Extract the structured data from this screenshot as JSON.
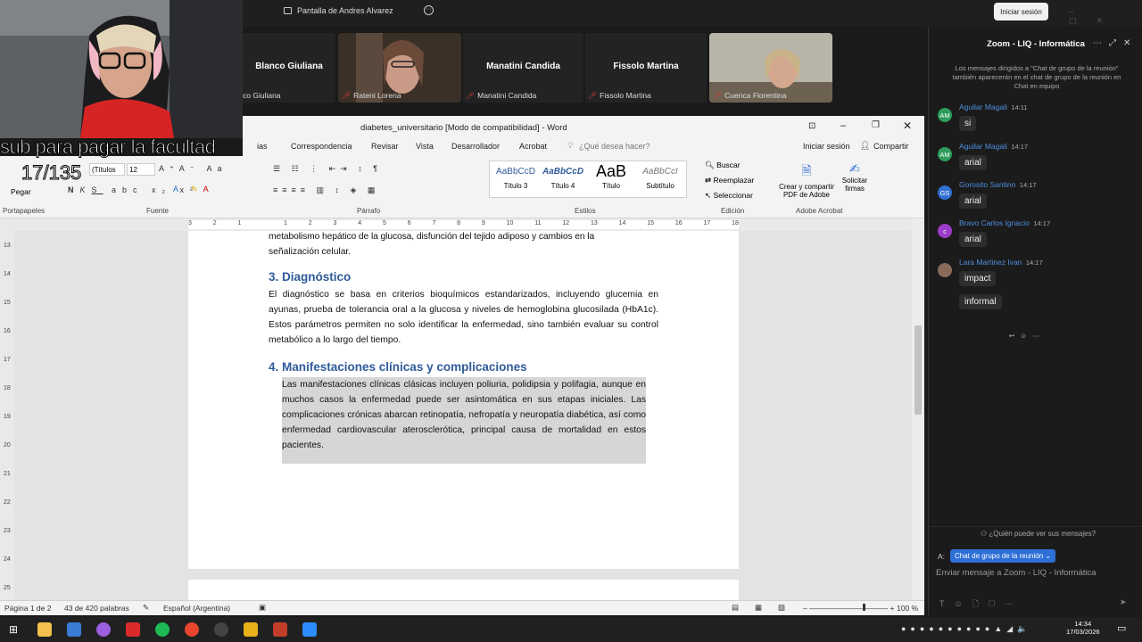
{
  "zoom": {
    "sharing_label": "Pantalla de Andres Alvarez",
    "signin_label": "Iniciar sesión",
    "participants": [
      {
        "name": "Blanco Giuliana",
        "label": "co Giuliana"
      },
      {
        "name": "",
        "label": "Rateni Lorena"
      },
      {
        "name": "Manatini Candida",
        "label": "Manatini Candida"
      },
      {
        "name": "Fissolo Martina",
        "label": "Fissolo Martina"
      },
      {
        "name": "",
        "label": "Cuenca Florentina"
      }
    ]
  },
  "overlay": {
    "line1": "sub para pagar la facultad",
    "line2": "17/135"
  },
  "word": {
    "title": "diabetes_universitario [Modo de compatibilidad] - Word",
    "menu": [
      "ias",
      "Correspondencia",
      "Revisar",
      "Vista",
      "Desarrollador",
      "Acrobat"
    ],
    "tell_me": "¿Qué desea hacer?",
    "signin": "Iniciar sesión",
    "share": "Compartir",
    "ribbon": {
      "paste": "Pegar",
      "font_name": "(Títulos",
      "font_size": "12",
      "groups": [
        "Portapapeles",
        "Fuente",
        "Párrafo",
        "Estilos",
        "Edición",
        "Adobe Acrobat"
      ],
      "styles": [
        {
          "preview": "AaBbCcD",
          "name": "Título 3"
        },
        {
          "preview": "AaBbCcD",
          "name": "Título 4"
        },
        {
          "preview": "AaB",
          "name": "Título"
        },
        {
          "preview": "AaBbCcI",
          "name": "Subtítulo"
        }
      ],
      "find": "Buscar",
      "replace": "Reemplazar",
      "select": "Seleccionar",
      "acrobat_create": "Crear y compartir PDF de Adobe",
      "acrobat_sign": "Solicitar firmas"
    },
    "ruler_numbers": [
      "3",
      "2",
      "1",
      "",
      "1",
      "2",
      "3",
      "4",
      "5",
      "6",
      "7",
      "8",
      "9",
      "10",
      "11",
      "12",
      "13",
      "14",
      "15",
      "16",
      "17",
      "18"
    ],
    "vruler_numbers": [
      "13",
      "14",
      "15",
      "16",
      "17",
      "18",
      "19",
      "20",
      "21",
      "22",
      "23",
      "24",
      "25"
    ],
    "doc": {
      "para1_line1": "metabolismo hepático de la glucosa, disfunción del tejido adiposo y cambios en la",
      "para1_line2": "señalización celular.",
      "h3": "3. Diagnóstico",
      "para2": "El diagnóstico se basa en criterios bioquímicos estandarizados, incluyendo glucemia en ayunas, prueba de tolerancia oral a la glucosa y niveles de hemoglobina glucosilada (HbA1c). Estos parámetros permiten no solo identificar la enfermedad, sino también evaluar su control metabólico a lo largo del tiempo.",
      "h4": "4. Manifestaciones clínicas y complicaciones",
      "para3": "Las manifestaciones clínicas clásicas incluyen poliuria, polidipsia y polifagia, aunque en muchos casos la enfermedad puede ser asintomática en sus etapas iniciales. Las complicaciones crónicas abarcan retinopatía, nefropatía y neuropatía diabética, así como enfermedad cardiovascular aterosclerótica, principal causa de mortalidad en estos pacientes."
    },
    "status": {
      "page": "Página 1 de 2",
      "words": "43 de 420 palabras",
      "language": "Español (Argentina)",
      "zoom": "100 %"
    }
  },
  "chat": {
    "title": "Zoom - LIQ - Informática",
    "notice": "Los mensajes dirigidos a \"Chat de grupo de la reunión\" también aparecerán en el chat de grupo de la reunión en Chat en equipo",
    "messages": [
      {
        "initials": "AM",
        "color": "#2e9d5b",
        "name": "Aguilar Magali",
        "time": "14:11",
        "texts": [
          "si"
        ]
      },
      {
        "initials": "AM",
        "color": "#2e9d5b",
        "name": "Aguilar Magali",
        "time": "14:17",
        "texts": [
          "arial"
        ]
      },
      {
        "initials": "GS",
        "color": "#2f6fd1",
        "name": "Gorosito Santino",
        "time": "14:17",
        "texts": [
          "arial"
        ]
      },
      {
        "initials": "c",
        "color": "#9c3bc7",
        "name": "Bravo Carlos Ignacio",
        "time": "14:17",
        "texts": [
          "arial"
        ]
      },
      {
        "initials": "",
        "color": "#8a6b5a",
        "name": "Lara Martinez Ivan",
        "time": "14:17",
        "texts": [
          "impact",
          "informal"
        ]
      }
    ],
    "who_can_see": "¿Quién puede ver sus mensajes?",
    "to_label": "A:",
    "recipient": "Chat de grupo de la reunión",
    "placeholder": "Enviar mensaje a Zoom - LIQ - Informática"
  },
  "taskbar": {
    "time": "14:34",
    "date": "17/03/2026"
  }
}
